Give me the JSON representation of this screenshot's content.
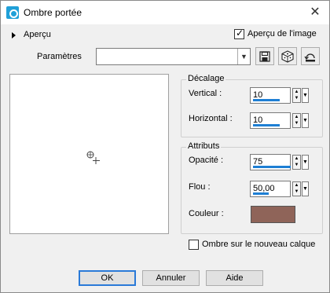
{
  "window": {
    "title": "Ombre portée",
    "close_glyph": "✕"
  },
  "apercu": {
    "label": "Aperçu"
  },
  "preview_checkbox": {
    "label": "Aperçu de l'image",
    "checked": true
  },
  "parametres": {
    "label": "Paramètres",
    "value": ""
  },
  "toolbar": {
    "save_icon": "save-icon",
    "random_icon": "dice-icon",
    "reset_icon": "reset-icon"
  },
  "decalage": {
    "legend": "Décalage",
    "vertical_label": "Vertical :",
    "vertical_value": "10",
    "horizontal_label": "Horizontal :",
    "horizontal_value": "10"
  },
  "attributs": {
    "legend": "Attributs",
    "opacite_label": "Opacité :",
    "opacite_value": "75",
    "flou_label": "Flou :",
    "flou_value": "50,00",
    "couleur_label": "Couleur :",
    "couleur_value": "#8f6459"
  },
  "new_layer_checkbox": {
    "label": "Ombre sur le nouveau calque",
    "checked": false
  },
  "buttons": {
    "ok": "OK",
    "cancel": "Annuler",
    "help": "Aide"
  },
  "colors": {
    "accent": "#1e7fd4",
    "shadow_color": "#8f6459"
  }
}
